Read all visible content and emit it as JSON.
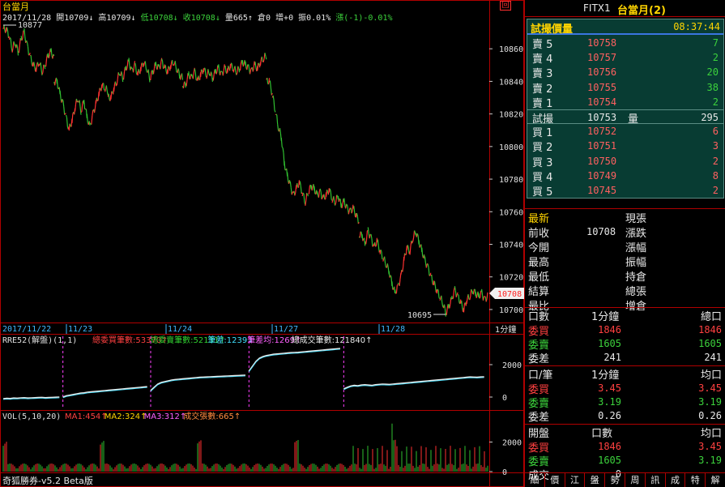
{
  "window": {
    "title": "台當月",
    "symbol": "FITX1",
    "symbol_name": "台當月(2)"
  },
  "info_bar": {
    "date": "2017/11/28",
    "open": "開10709↓",
    "high": "高10709↓",
    "low": "低10708↓",
    "close": "收10708↓",
    "volume": "量665↑",
    "oi": "倉0",
    "oi_change": "增+0",
    "amplitude": "振0.01%",
    "change": "漲(-1)-0.01%"
  },
  "chart_labels": {
    "high_marker": "10877",
    "low_marker": "10695",
    "last_price_marker": "10708",
    "period_label": "1分鐘",
    "restore_icon_label": "回"
  },
  "colors": {
    "up": "#ff3030",
    "down": "#30c030",
    "border": "#b00000",
    "accent_yellow": "#ffd400",
    "panel_bg": "#083c33"
  },
  "chart_data": [
    {
      "type": "line",
      "name": "price-1min",
      "y_ticks": [
        "10860",
        "10840",
        "10820",
        "10800",
        "10780",
        "10760",
        "10740",
        "10720",
        "10700"
      ],
      "ylim": [
        10695,
        10877
      ],
      "x_ticks": [
        "2017/11/22",
        "11/23",
        "11/24",
        "11/27",
        "11/28"
      ],
      "segments": [
        {
          "label": "2017/11/22",
          "points": [
            10872,
            10868,
            10860,
            10864,
            10858,
            10866,
            10870,
            10862,
            10855,
            10850,
            10848,
            10852,
            10846,
            10850,
            10856,
            10858,
            10854
          ]
        },
        {
          "label": "11/22b",
          "points": [
            10840,
            10832,
            10826,
            10818,
            10810,
            10816,
            10824,
            10830,
            10822,
            10828,
            10818,
            10812,
            10820,
            10826,
            10832,
            10838,
            10836,
            10834
          ]
        },
        {
          "label": "11/23",
          "points": [
            10830,
            10836,
            10840,
            10846,
            10842,
            10848,
            10852,
            10846,
            10850,
            10844,
            10848,
            10852,
            10848,
            10842,
            10846,
            10850,
            10848,
            10852,
            10848,
            10846,
            10850,
            10852,
            10848,
            10844,
            10842
          ]
        },
        {
          "label": "11/24",
          "points": [
            10838,
            10844,
            10842,
            10846,
            10840,
            10844,
            10848,
            10844,
            10846,
            10842,
            10846,
            10848,
            10844,
            10848,
            10846,
            10850,
            10848,
            10846,
            10848,
            10852,
            10850,
            10848,
            10846,
            10850,
            10848,
            10852,
            10854,
            10856
          ]
        },
        {
          "label": "11/27",
          "points": [
            10840,
            10832,
            10822,
            10812,
            10806,
            10790,
            10782,
            10776,
            10770,
            10774,
            10778,
            10772,
            10766,
            10772,
            10776,
            10774,
            10770,
            10772,
            10768,
            10770,
            10774,
            10768,
            10766,
            10770,
            10764,
            10766,
            10762,
            10760,
            10762,
            10758,
            10754
          ]
        },
        {
          "label": "11/28",
          "points": [
            10746,
            10740,
            10748,
            10744,
            10738,
            10742,
            10736,
            10732,
            10728,
            10724,
            10716,
            10710,
            10714,
            10720,
            10730,
            10738,
            10736,
            10744,
            10748,
            10742,
            10736,
            10730,
            10726,
            10720,
            10716,
            10712,
            10708,
            10704,
            10698,
            10702,
            10706,
            10712,
            10708,
            10704,
            10700,
            10706,
            10708,
            10712,
            10710,
            10708,
            10710,
            10706,
            10708
          ]
        }
      ]
    },
    {
      "type": "line",
      "name": "rre52-indicator",
      "header": "RRE52(解盤)(1,1)",
      "items": [
        {
          "label": "總委買筆數:53370↑",
          "color": "#ff4040"
        },
        {
          "label": "總委賣筆數:52131↑",
          "color": "#30d030"
        },
        {
          "label": "筆差:1239↓",
          "color": "#40e0ff"
        },
        {
          "label": "筆差均:1269↑",
          "color": "#ff60ff"
        },
        {
          "label": "總成交筆數:121840↑",
          "color": "#e8e8e8"
        }
      ],
      "y_ticks": [
        "2000",
        "0"
      ],
      "ylim": [
        -500,
        3000
      ],
      "segments": [
        {
          "points": [
            -100,
            -80,
            -90,
            -60,
            -70,
            -50,
            -40,
            -60,
            -50,
            -40,
            -30,
            -20,
            -40,
            -30,
            -20,
            -10,
            0
          ]
        },
        {
          "points": [
            0,
            80,
            120,
            160,
            200,
            240,
            260,
            300,
            320,
            340,
            360,
            380,
            400,
            420,
            440,
            460,
            480,
            500,
            520,
            540,
            560,
            580,
            600,
            620,
            640
          ]
        },
        {
          "points": [
            400,
            600,
            800,
            900,
            950,
            1000,
            1050,
            1080,
            1100,
            1120,
            1140,
            1160,
            1180,
            1200,
            1220,
            1230,
            1240,
            1250,
            1260,
            1270,
            1280,
            1290,
            1300,
            1310,
            1320,
            1330,
            1340,
            1350
          ]
        },
        {
          "points": [
            1600,
            1900,
            2200,
            2400,
            2500,
            2560,
            2600,
            2640,
            2660,
            2680,
            2700,
            2720,
            2740,
            2750,
            2760,
            2780,
            2800,
            2820,
            2840,
            2860,
            2880,
            2900,
            2920,
            2940,
            2960,
            2980,
            3000
          ]
        },
        {
          "points": [
            500,
            600,
            680,
            720,
            700,
            740,
            760,
            740,
            720,
            760,
            780,
            800,
            790,
            780,
            800,
            820,
            840,
            860,
            880,
            900,
            920,
            940,
            960,
            980,
            1000,
            1020,
            1040,
            1060,
            1080,
            1100,
            1120,
            1140,
            1160,
            1180,
            1200,
            1220,
            1240,
            1230,
            1220,
            1240,
            1250
          ]
        }
      ]
    },
    {
      "type": "bar",
      "name": "volume",
      "header": "VOL(5,10,20)",
      "items": [
        {
          "label": "MA1:454↑",
          "color": "#ff4040"
        },
        {
          "label": "MA2:324↑",
          "color": "#ffd400"
        },
        {
          "label": "MA3:312↑",
          "color": "#ff60ff"
        },
        {
          "label": "成交張數:665↑",
          "color": "#ff8c40"
        }
      ],
      "y_ticks": [
        "2000",
        "0"
      ],
      "ylim": [
        0,
        3400
      ]
    }
  ],
  "order_book": {
    "title": "試撮價量",
    "time": "08:37:44",
    "asks": [
      {
        "label": "賣 5",
        "price": "10758",
        "qty": "7"
      },
      {
        "label": "賣 4",
        "price": "10757",
        "qty": "2"
      },
      {
        "label": "賣 3",
        "price": "10756",
        "qty": "20"
      },
      {
        "label": "賣 2",
        "price": "10755",
        "qty": "38"
      },
      {
        "label": "賣 1",
        "price": "10754",
        "qty": "2"
      }
    ],
    "match": {
      "label": "試撮",
      "price": "10753",
      "qty_label": "量",
      "qty": "295"
    },
    "bids": [
      {
        "label": "買 1",
        "price": "10752",
        "qty": "6"
      },
      {
        "label": "買 2",
        "price": "10751",
        "qty": "3"
      },
      {
        "label": "買 3",
        "price": "10750",
        "qty": "2"
      },
      {
        "label": "買 4",
        "price": "10749",
        "qty": "8"
      },
      {
        "label": "買 5",
        "price": "10745",
        "qty": "2"
      }
    ]
  },
  "stats": {
    "left": [
      {
        "label": "最新",
        "value": ""
      },
      {
        "label": "前收",
        "value": "10708"
      },
      {
        "label": "今開",
        "value": ""
      },
      {
        "label": "最高",
        "value": ""
      },
      {
        "label": "最低",
        "value": ""
      },
      {
        "label": "結算",
        "value": ""
      },
      {
        "label": "最比",
        "value": ""
      }
    ],
    "right": [
      {
        "label": "現張",
        "value": ""
      },
      {
        "label": "漲跌",
        "value": ""
      },
      {
        "label": "漲幅",
        "value": ""
      },
      {
        "label": "振幅",
        "value": ""
      },
      {
        "label": "持倉",
        "value": ""
      },
      {
        "label": "總張",
        "value": ""
      },
      {
        "label": "增倉",
        "value": ""
      }
    ]
  },
  "sections": [
    {
      "head": [
        "口數",
        "1分鐘",
        "總口"
      ],
      "rows": [
        {
          "label": "委買",
          "a": "1846",
          "b": "1846"
        },
        {
          "label": "委賣",
          "a": "1605",
          "b": "1605"
        },
        {
          "label": "委差",
          "a": "241",
          "b": "241"
        }
      ]
    },
    {
      "head": [
        "口/筆",
        "1分鐘",
        "均口"
      ],
      "rows": [
        {
          "label": "委買",
          "a": "3.45",
          "b": "3.45"
        },
        {
          "label": "委賣",
          "a": "3.19",
          "b": "3.19"
        },
        {
          "label": "委差",
          "a": "0.26",
          "b": "0.26"
        }
      ]
    },
    {
      "head": [
        "開盤",
        "口數",
        "均口"
      ],
      "rows": [
        {
          "label": "委買",
          "a": "1846",
          "b": "3.45"
        },
        {
          "label": "委賣",
          "a": "1605",
          "b": "3.19"
        },
        {
          "label": "成交",
          "a": "0",
          "b": ""
        }
      ]
    }
  ],
  "tabs": [
    "細",
    "價",
    "江",
    "盤",
    "勢",
    "周",
    "訊",
    "成",
    "特",
    "解"
  ],
  "status": {
    "app_name": "奇狐勝券-v5.2 Beta版"
  }
}
